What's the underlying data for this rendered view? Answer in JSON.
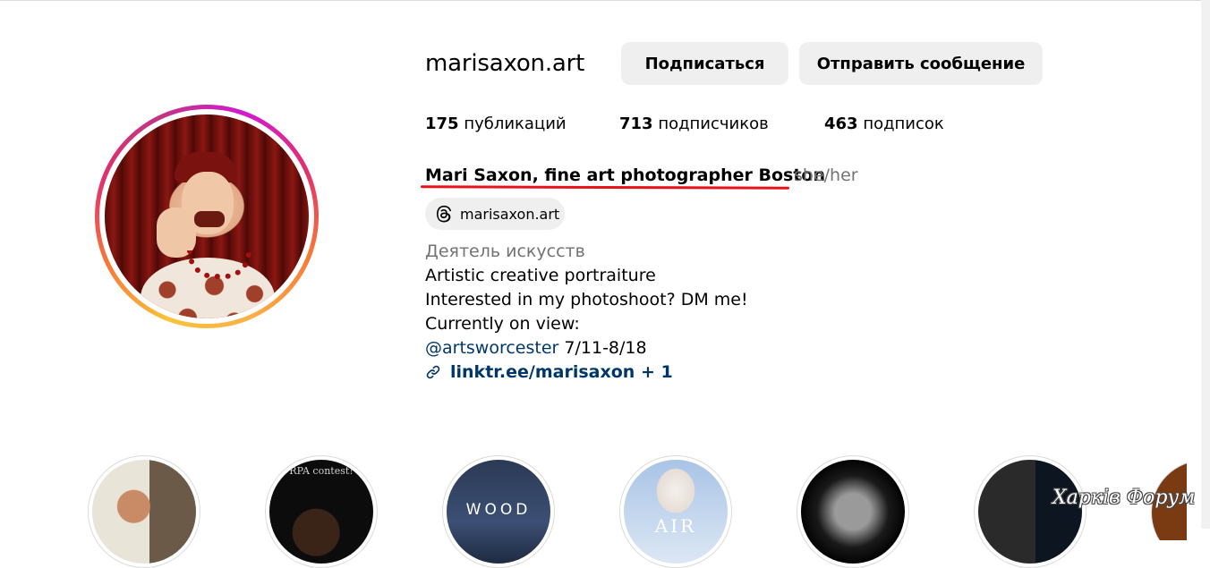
{
  "profile": {
    "username": "marisaxon.art",
    "follow_label": "Подписаться",
    "message_label": "Отправить сообщение",
    "stats": {
      "posts_count": "175",
      "posts_label": "публикаций",
      "followers_count": "713",
      "followers_label": "подписчиков",
      "following_count": "463",
      "following_label": "подписок"
    },
    "full_name": "Mari Saxon, fine art photographer Boston",
    "pronouns": "she/her",
    "threads_handle": "marisaxon.art",
    "category": "Деятель искусств",
    "bio_lines": [
      "Artistic creative portraiture",
      "Interested in my photoshoot? DM me!",
      "Currently on view:"
    ],
    "mention": "@artsworcester",
    "mention_suffix": " 7/11-8/18",
    "link_text": "linktr.ee/marisaxon",
    "link_extra": " + 1"
  },
  "highlights": [
    {
      "text": ""
    },
    {
      "text": "RPA contest!"
    },
    {
      "text": "WOOD"
    },
    {
      "text": "AIR"
    },
    {
      "text": ""
    },
    {
      "text": ""
    }
  ],
  "watermark": "Харків Форум",
  "colors": {
    "button_bg": "#efefef",
    "link_blue": "#00376b",
    "secondary_text": "#737373",
    "annotation_red": "#e8131a"
  },
  "icons": {
    "threads": "threads-icon",
    "link": "link-icon"
  }
}
